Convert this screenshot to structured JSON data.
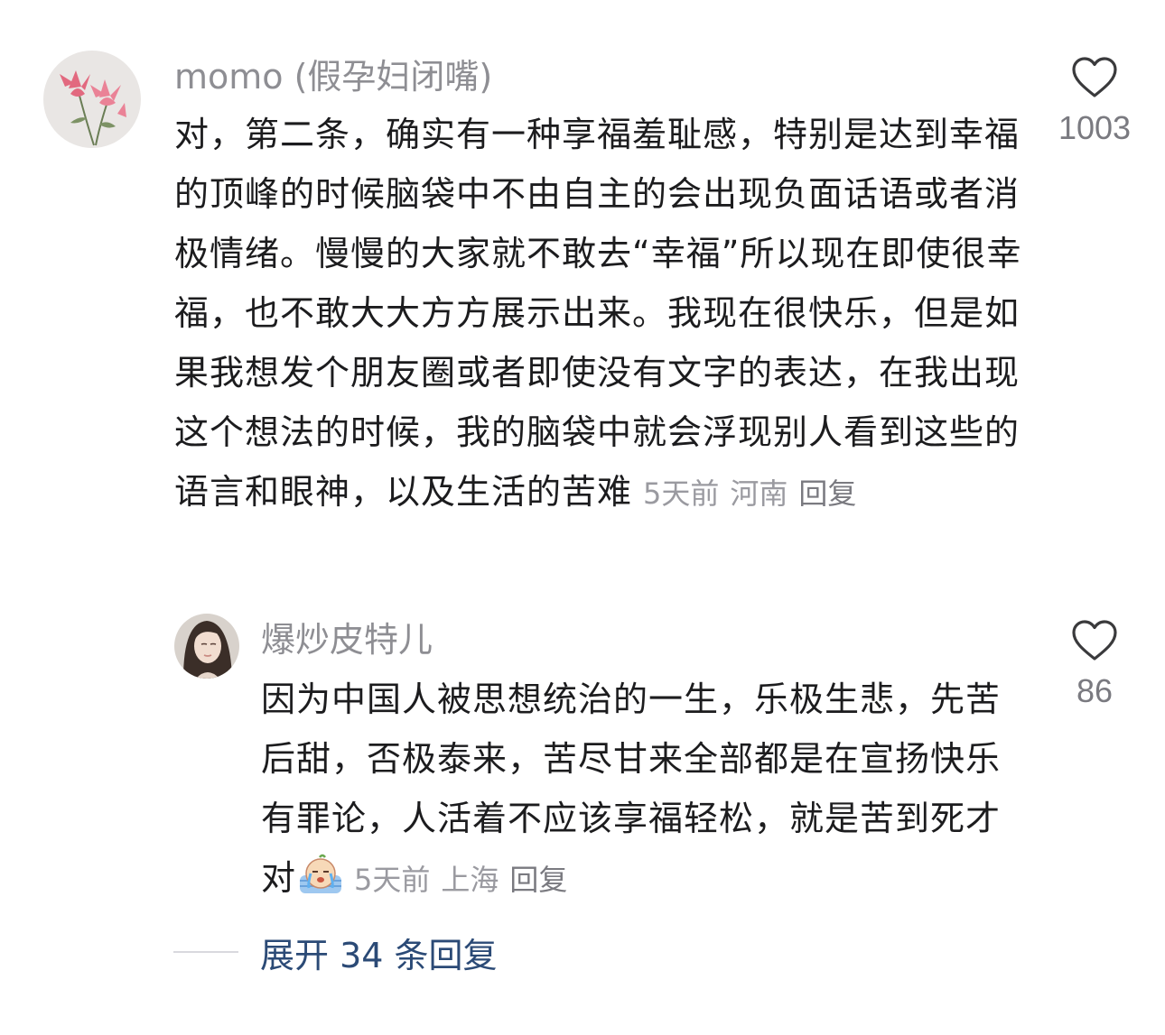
{
  "comments": [
    {
      "username": "momo (假孕妇闭嘴)",
      "text": "对，第二条，确实有一种享福羞耻感，特别是达到幸福的顶峰的时候脑袋中不由自主的会出现负面话语或者消极情绪。慢慢的大家就不敢去“幸福”所以现在即使很幸福，也不敢大大方方展示出来。我现在很快乐，但是如果我想发个朋友圈或者即使没有文字的表达，在我出现这个想法的时候，我的脑袋中就会浮现别人看到这些的语言和眼神，以及生活的苦难",
      "time": "5天前",
      "location": "河南",
      "reply_label": "回复",
      "like_count": "1003",
      "avatar_icon": "pink-lotus-flower-avatar"
    },
    {
      "username": "爆炒皮特儿",
      "text": "因为中国人被思想统治的一生，乐极生悲，先苦后甜，否极泰来，苦尽甘来全部都是在宣扬快乐有罪论，人活着不应该享福轻松，就是苦到死才对",
      "emoji_icon": "crying-face-emoji",
      "time": "5天前",
      "location": "上海",
      "reply_label": "回复",
      "like_count": "86",
      "avatar_icon": "woman-portrait-avatar"
    }
  ],
  "expand_replies": {
    "label": "展开 34 条回复"
  },
  "colors": {
    "text": "#1c1c1e",
    "secondary": "#8e8e93",
    "link": "#2b4a76"
  }
}
